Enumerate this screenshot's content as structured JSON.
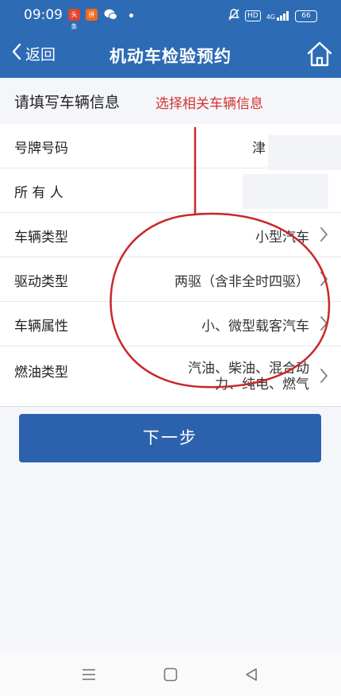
{
  "status_bar": {
    "time": "09:09",
    "app_icon_1": "头条",
    "app_icon_2": "拼",
    "network": "4G",
    "battery": "66"
  },
  "nav": {
    "back_label": "返回",
    "title": "机动车检验预约"
  },
  "section": {
    "title": "请填写车辆信息",
    "annotation": "选择相关车辆信息"
  },
  "rows": [
    {
      "label": "号牌号码",
      "value": "津"
    },
    {
      "label": "所 有 人",
      "value": ""
    },
    {
      "label": "车辆类型",
      "value": "小型汽车"
    },
    {
      "label": "驱动类型",
      "value": "两驱（含非全时四驱）"
    },
    {
      "label": "车辆属性",
      "value": "小、微型载客汽车"
    },
    {
      "label": "燃油类型",
      "value_line1": "汽油、柴油、混合动",
      "value_line2": "力、纯电、燃气"
    }
  ],
  "next_button": "下一步",
  "colors": {
    "primary": "#2d6bb5",
    "button": "#2c62ad",
    "annotation": "#d43230",
    "background": "#f4f6f9"
  }
}
